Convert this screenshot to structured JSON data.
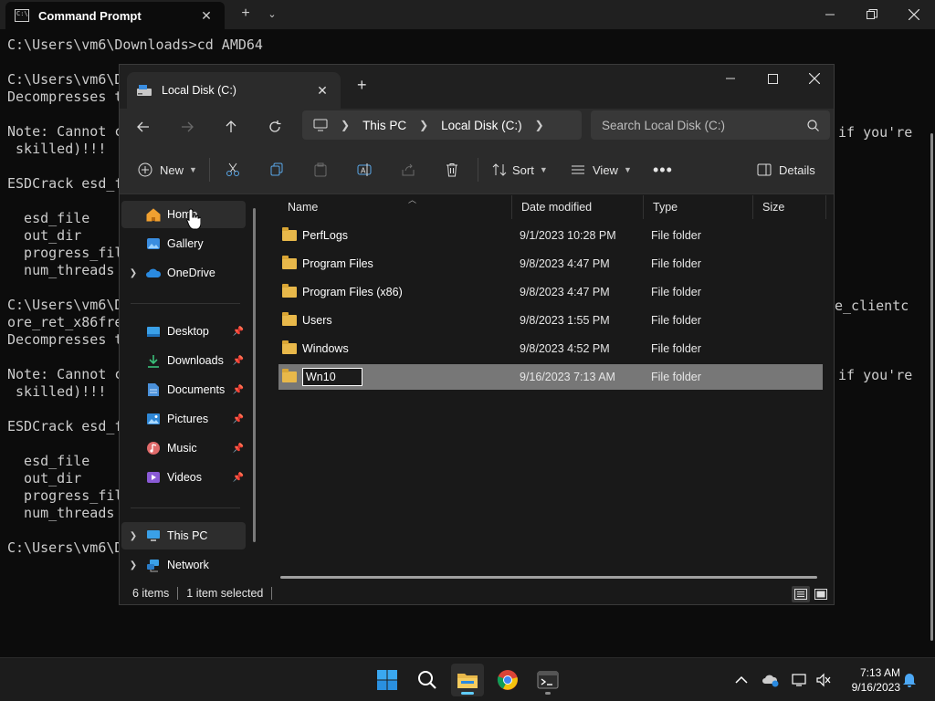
{
  "cmd": {
    "tab_title": "Command Prompt",
    "lines": [
      "C:\\Users\\vm6\\Downloads>cd AMD64",
      "",
      "C:\\Users\\vm6\\D",
      "Decompresses t",
      "",
      "Note: Cannot c",
      " skilled)!!!",
      "",
      "ESDCrack esd_f",
      "",
      "  esd_file",
      "  out_dir",
      "  progress_fil",
      "  num_threads",
      "",
      "C:\\Users\\vm6\\D",
      "ore_ret_x86fre",
      "Decompresses t",
      "",
      "Note: Cannot c",
      " skilled)!!!",
      "",
      "ESDCrack esd_f",
      "",
      "  esd_file",
      "  out_dir",
      "  progress_fil",
      "  num_threads",
      "",
      "C:\\Users\\vm6\\D"
    ],
    "right_fragments": {
      "a": "if you're",
      "b": "e_clientc",
      "c": "if you're"
    }
  },
  "explorer": {
    "tab_title": "Local Disk (C:)",
    "breadcrumb": [
      "This PC",
      "Local Disk (C:)"
    ],
    "search_placeholder": "Search Local Disk (C:)",
    "toolbar": {
      "new_label": "New",
      "sort_label": "Sort",
      "view_label": "View",
      "details_label": "Details"
    },
    "nav": {
      "home": "Home",
      "gallery": "Gallery",
      "onedrive": "OneDrive",
      "desktop": "Desktop",
      "downloads": "Downloads",
      "documents": "Documents",
      "pictures": "Pictures",
      "music": "Music",
      "videos": "Videos",
      "this_pc": "This PC",
      "network": "Network"
    },
    "columns": {
      "name": "Name",
      "date": "Date modified",
      "type": "Type",
      "size": "Size"
    },
    "files": [
      {
        "name": "PerfLogs",
        "date": "9/1/2023 10:28 PM",
        "type": "File folder"
      },
      {
        "name": "Program Files",
        "date": "9/8/2023 4:47 PM",
        "type": "File folder"
      },
      {
        "name": "Program Files (x86)",
        "date": "9/8/2023 4:47 PM",
        "type": "File folder"
      },
      {
        "name": "Users",
        "date": "9/8/2023 1:55 PM",
        "type": "File folder"
      },
      {
        "name": "Windows",
        "date": "9/8/2023 4:52 PM",
        "type": "File folder"
      },
      {
        "name": "Wn10",
        "date": "9/16/2023 7:13 AM",
        "type": "File folder"
      }
    ],
    "status": {
      "items": "6 items",
      "selected": "1 item selected"
    }
  },
  "taskbar": {
    "time": "7:13 AM",
    "date": "9/16/2023"
  }
}
